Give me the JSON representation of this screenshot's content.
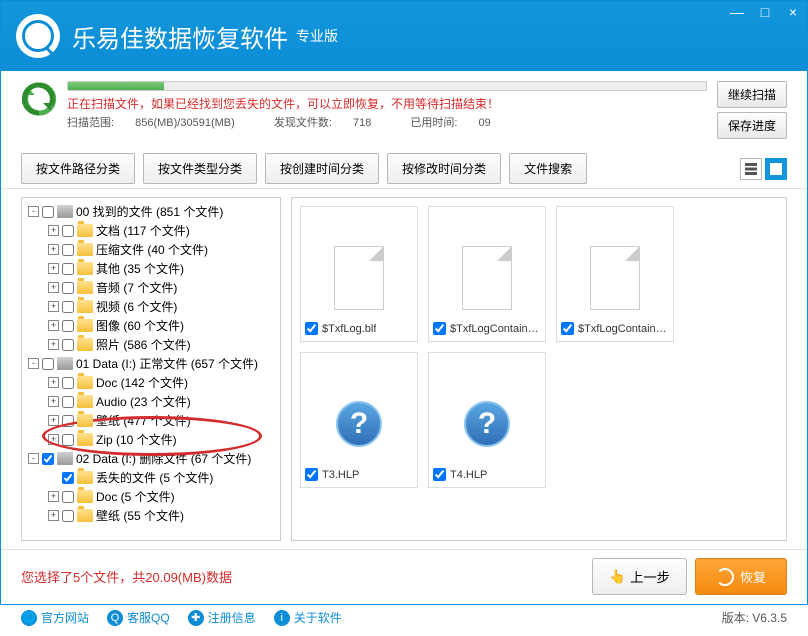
{
  "app": {
    "title": "乐易佳数据恢复软件",
    "subtitle": "专业版"
  },
  "win_controls": {
    "min": "—",
    "max": "□",
    "close": "×"
  },
  "status": {
    "message": "正在扫描文件，如果已经找到您丢失的文件，可以立即恢复，不用等待扫描结束！",
    "range_label": "扫描范围:",
    "range_value": "856(MB)/30591(MB)",
    "found_label": "发现文件数:",
    "found_value": "718",
    "time_label": "已用时间:",
    "time_value": "09"
  },
  "side_buttons": {
    "continue": "继续扫描",
    "save": "保存进度"
  },
  "tabs": {
    "t1": "按文件路径分类",
    "t2": "按文件类型分类",
    "t3": "按创建时间分类",
    "t4": "按修改时间分类",
    "t5": "文件搜索"
  },
  "tree": [
    {
      "depth": 0,
      "toggle": "-",
      "checked": false,
      "icon": "drv",
      "label": "00 找到的文件  (851 个文件)"
    },
    {
      "depth": 1,
      "toggle": "+",
      "checked": false,
      "icon": "fld",
      "label": "文档    (117 个文件)"
    },
    {
      "depth": 1,
      "toggle": "+",
      "checked": false,
      "icon": "fld",
      "label": "压缩文件   (40 个文件)"
    },
    {
      "depth": 1,
      "toggle": "+",
      "checked": false,
      "icon": "fld",
      "label": "其他   (35 个文件)"
    },
    {
      "depth": 1,
      "toggle": "+",
      "checked": false,
      "icon": "fld",
      "label": "音频   (7 个文件)"
    },
    {
      "depth": 1,
      "toggle": "+",
      "checked": false,
      "icon": "fld",
      "label": "视频   (6 个文件)"
    },
    {
      "depth": 1,
      "toggle": "+",
      "checked": false,
      "icon": "fld",
      "label": "图像   (60 个文件)"
    },
    {
      "depth": 1,
      "toggle": "+",
      "checked": false,
      "icon": "fld",
      "label": "照片   (586 个文件)"
    },
    {
      "depth": 0,
      "toggle": "-",
      "checked": false,
      "icon": "drv",
      "label": "01 Data (I:)  正常文件 (657 个文件)"
    },
    {
      "depth": 1,
      "toggle": "+",
      "checked": false,
      "icon": "fld",
      "label": "Doc   (142 个文件)"
    },
    {
      "depth": 1,
      "toggle": "+",
      "checked": false,
      "icon": "fld",
      "label": "Audio   (23 个文件)"
    },
    {
      "depth": 1,
      "toggle": "+",
      "checked": false,
      "icon": "fld",
      "label": "壁纸   (477 个文件)"
    },
    {
      "depth": 1,
      "toggle": "+",
      "checked": false,
      "icon": "fld",
      "label": "Zip   (10 个文件)"
    },
    {
      "depth": 0,
      "toggle": "-",
      "checked": true,
      "icon": "drv",
      "label": "02 Data (I:)  删除文件 (67 个文件)",
      "highlighted_top": true
    },
    {
      "depth": 1,
      "toggle": "",
      "checked": true,
      "icon": "fld",
      "label": "丢失的文件    (5 个文件)",
      "highlighted": true
    },
    {
      "depth": 1,
      "toggle": "+",
      "checked": false,
      "icon": "fld",
      "label": "Doc   (5 个文件)",
      "highlighted_bottom": true
    },
    {
      "depth": 1,
      "toggle": "+",
      "checked": false,
      "icon": "fld",
      "label": "壁纸   (55 个文件)"
    }
  ],
  "files": [
    {
      "name": "$TxfLog.blf",
      "icon": "page",
      "checked": true
    },
    {
      "name": "$TxfLogContainer...",
      "icon": "page",
      "checked": true
    },
    {
      "name": "$TxfLogContainer...",
      "icon": "page",
      "checked": true
    },
    {
      "name": "T3.HLP",
      "icon": "q",
      "checked": true
    },
    {
      "name": "T4.HLP",
      "icon": "q",
      "checked": true
    }
  ],
  "summary": {
    "prefix": "您选择了",
    "count": "5",
    "mid": "个文件，共",
    "size": "20.09(MB)",
    "suffix": "数据"
  },
  "actions": {
    "prev": "上一步",
    "recover": "恢复"
  },
  "bottombar": {
    "site": "官方网站",
    "qq": "客服QQ",
    "reg": "注册信息",
    "about": "关于软件",
    "version_label": "版本:",
    "version": "V6.3.5"
  }
}
